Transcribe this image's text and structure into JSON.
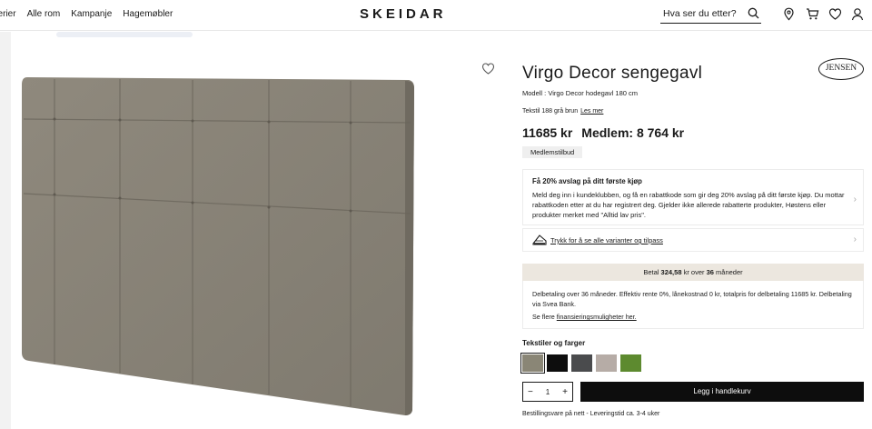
{
  "header": {
    "nav": [
      "Interiør",
      "Alle rom",
      "Kampanje",
      "Hagemøbler"
    ],
    "nav_visible": [
      "ıterier",
      "Alle rom",
      "Kampanje",
      "Hagemøbler"
    ],
    "logo": "SKEIDAR",
    "search_placeholder": "Hva ser du etter?",
    "icons": [
      "search-icon",
      "location-icon",
      "cart-icon",
      "heart-icon",
      "user-icon"
    ]
  },
  "product": {
    "title": "Virgo Decor sengegavl",
    "brand": "JENSEN",
    "model": "Modell : Virgo Decor hodegavl 180 cm",
    "fabric": "Tekstil 188 grå brun",
    "fabric_link": "Les mer",
    "price": "11685 kr",
    "member_price": "Medlem: 8 764 kr",
    "member_badge": "Medlemstilbud"
  },
  "promo": {
    "heading": "Få 20% avslag på ditt første kjøp",
    "body": "Meld deg inn i kundeklubben, og få en rabattkode som gir deg 20% avslag på ditt første kjøp. Du mottar rabattkoden etter at du har registrert deg. Gjelder ikke allerede rabatterte produkter, Høstens eller produkter merket med \"Alltid lav pris\"."
  },
  "variants": {
    "label": "Trykk for å se alle varianter og tilpass"
  },
  "payment": {
    "bar_prefix": "Betal",
    "bar_amount": "324,58",
    "bar_mid": "kr over",
    "bar_months": "36",
    "bar_suffix": "måneder",
    "info": "Delbetaling over 36 måneder. Effektiv rente 0%, lånekostnad 0 kr, totalpris for delbetaling 11685 kr. Delbetaling via Svea Bank.",
    "more_prefix": "Se flere",
    "more_link": "finansieringsmuligheter her."
  },
  "textiles": {
    "heading": "Tekstiler og farger",
    "swatches": [
      "#8a8676",
      "#0d0d0d",
      "#4a4b4d",
      "#b6aca6",
      "#5d8a2f"
    ]
  },
  "cart": {
    "minus": "−",
    "quantity": "1",
    "plus": "+",
    "add_label": "Legg i handlekurv"
  },
  "shipping": "Bestillingsvare på nett - Leveringstid ca. 3-4 uker"
}
